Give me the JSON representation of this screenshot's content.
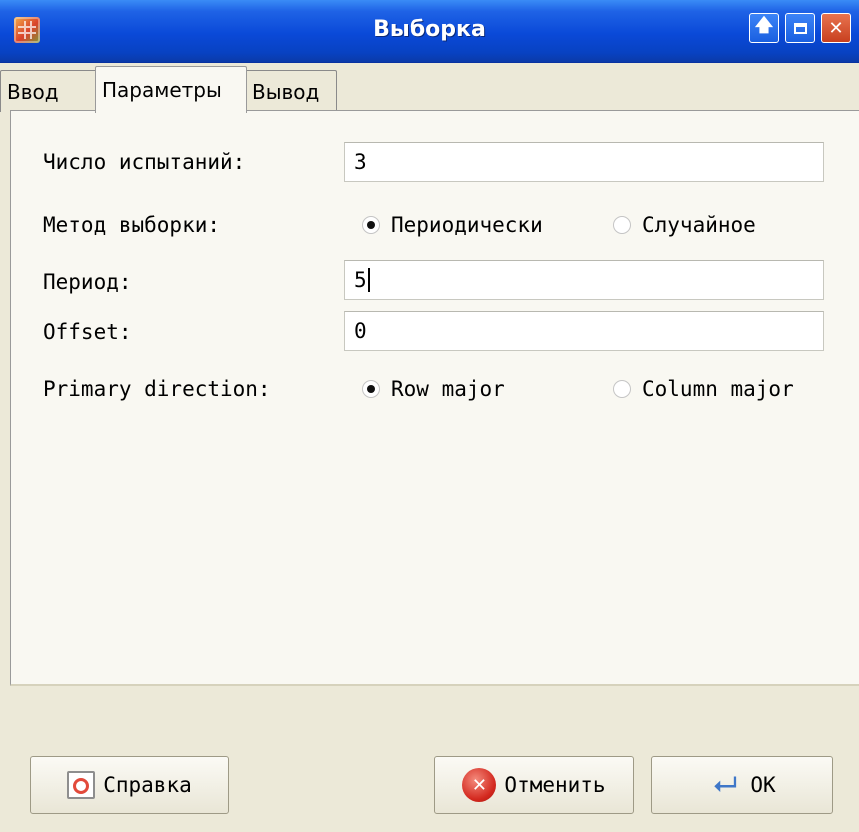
{
  "window": {
    "title": "Выборка"
  },
  "tabs": [
    {
      "label": "Ввод",
      "active": false
    },
    {
      "label": "Параметры",
      "active": true
    },
    {
      "label": "Вывод",
      "active": false
    }
  ],
  "form": {
    "trials_label": "Число испытаний:",
    "trials_value": "3",
    "method_label": "Метод выборки:",
    "method_options": [
      {
        "label": "Периодически",
        "selected": true
      },
      {
        "label": "Случайное",
        "selected": false
      }
    ],
    "period_label": "Период:",
    "period_value": "5",
    "offset_label": "Offset:",
    "offset_value": "0",
    "direction_label": "Primary direction:",
    "direction_options": [
      {
        "label": "Row major",
        "selected": true
      },
      {
        "label": "Column major",
        "selected": false
      }
    ]
  },
  "buttons": {
    "help": "Справка",
    "cancel": "Отменить",
    "ok": "OK"
  }
}
